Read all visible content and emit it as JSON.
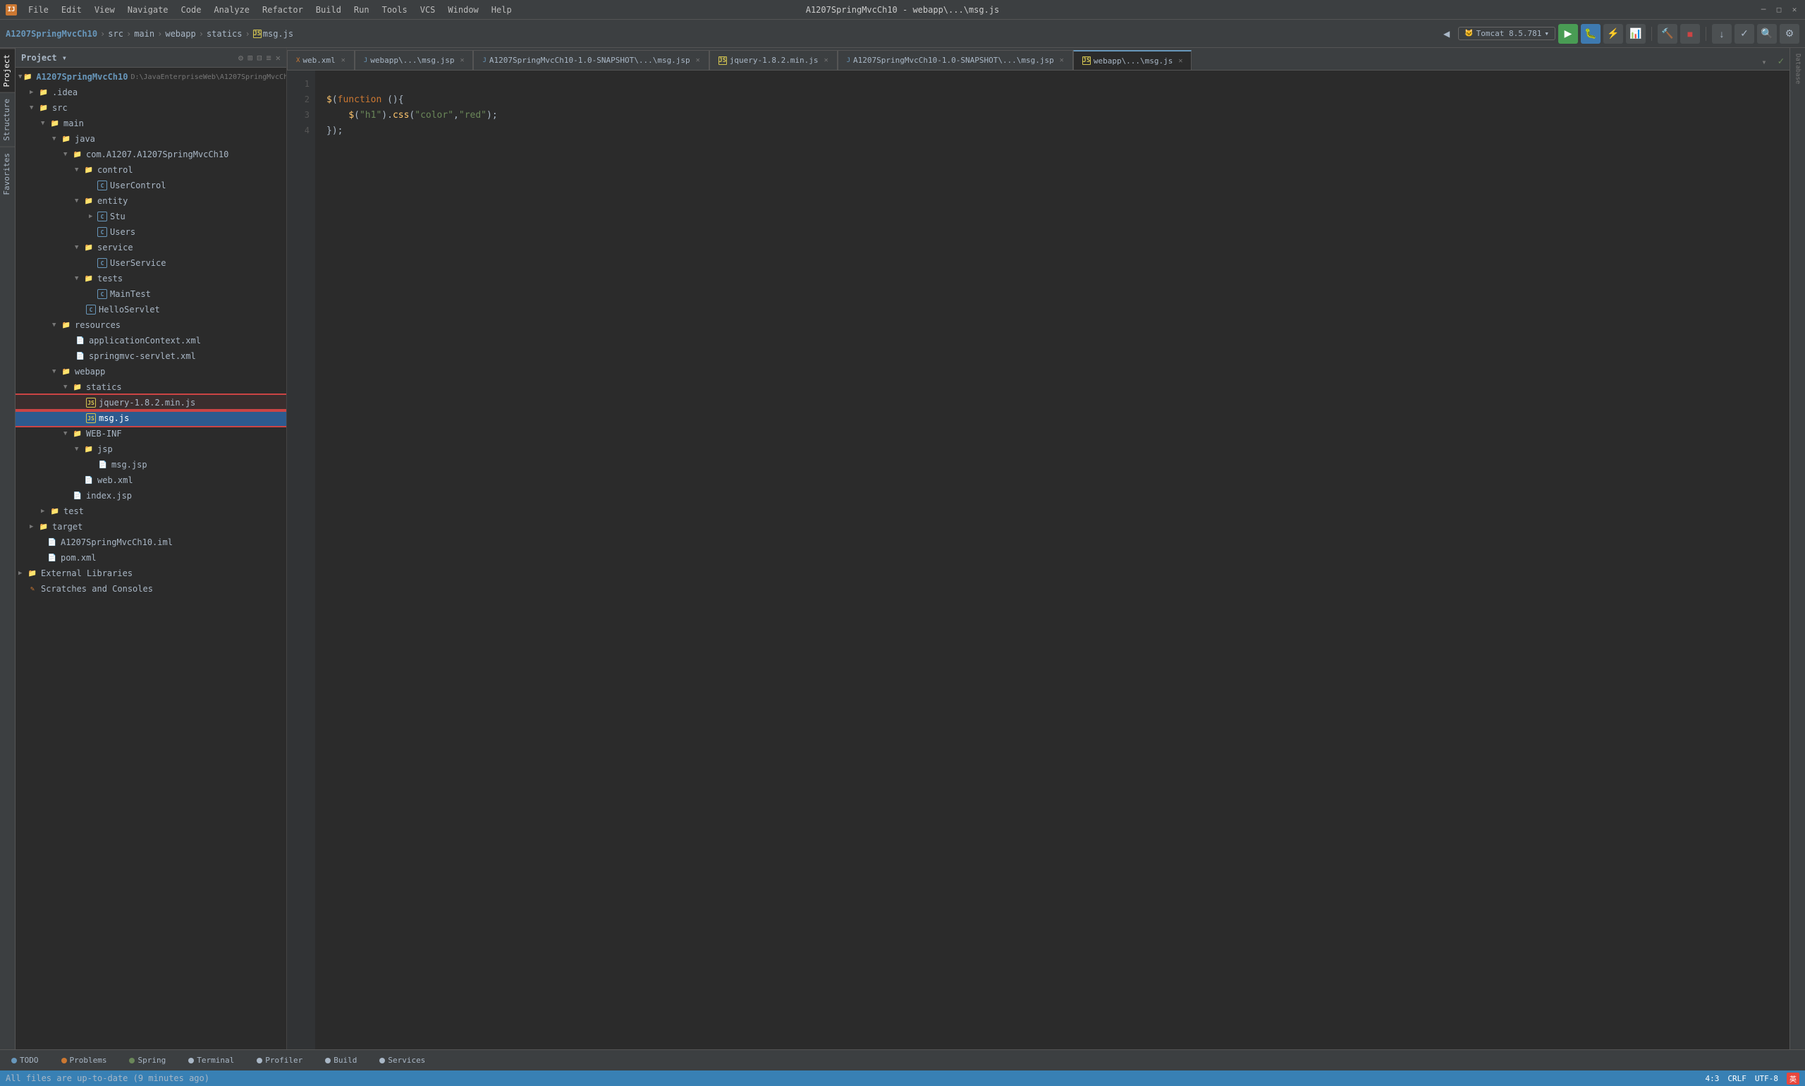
{
  "titlebar": {
    "app_name": "IntelliJ IDEA",
    "title": "A1207SpringMvcCh10 - webapp\\...\\msg.js",
    "menu": [
      "File",
      "Edit",
      "View",
      "Navigate",
      "Code",
      "Analyze",
      "Refactor",
      "Build",
      "Run",
      "Tools",
      "VCS",
      "Window",
      "Help"
    ]
  },
  "breadcrumb": {
    "project": "A1207SpringMvcCh10",
    "path": [
      "src",
      "main",
      "webapp",
      "statics",
      "msg.js"
    ]
  },
  "toolbar": {
    "tomcat": "Tomcat 8.5.781",
    "project_label": "Project ▾"
  },
  "tabs": [
    {
      "label": "web.xml",
      "type": "xml",
      "active": false
    },
    {
      "label": "webapp\\...\\msg.jsp",
      "type": "jsp",
      "active": false
    },
    {
      "label": "A1207SpringMvcCh10-1.0-SNAPSHOT\\...\\msg.jsp",
      "type": "jsp",
      "active": false
    },
    {
      "label": "jquery-1.8.2.min.js",
      "type": "js",
      "active": false
    },
    {
      "label": "A1207SpringMvcCh10-1.0-SNAPSHOT\\...\\msg.jsp",
      "type": "jsp",
      "active": false
    },
    {
      "label": "webapp\\...\\msg.js",
      "type": "js",
      "active": true
    }
  ],
  "code": {
    "lines": [
      {
        "num": 1,
        "content": ""
      },
      {
        "num": 2,
        "content": "$(function (){"
      },
      {
        "num": 3,
        "content": "    $(\"h1\").css(\"color\",\"red\");"
      },
      {
        "num": 4,
        "content": "});"
      }
    ]
  },
  "tree": {
    "project_name": "A1207SpringMvcCh10",
    "project_path": "D:\\JavaEnterpriseWeb\\A1207SpringMvcCh",
    "items": [
      {
        "label": ".idea",
        "type": "folder",
        "indent": 1,
        "expanded": false,
        "arrow": "▶"
      },
      {
        "label": "src",
        "type": "folder",
        "indent": 1,
        "expanded": true,
        "arrow": "▼"
      },
      {
        "label": "main",
        "type": "folder",
        "indent": 2,
        "expanded": true,
        "arrow": "▼"
      },
      {
        "label": "java",
        "type": "folder",
        "indent": 3,
        "expanded": true,
        "arrow": "▼"
      },
      {
        "label": "com.A1207.A1207SpringMvcCh10",
        "type": "folder",
        "indent": 4,
        "expanded": true,
        "arrow": "▼"
      },
      {
        "label": "control",
        "type": "folder",
        "indent": 5,
        "expanded": true,
        "arrow": "▼"
      },
      {
        "label": "UserControl",
        "type": "java",
        "indent": 6,
        "expanded": false,
        "arrow": ""
      },
      {
        "label": "entity",
        "type": "folder",
        "indent": 5,
        "expanded": true,
        "arrow": "▼"
      },
      {
        "label": "Stu",
        "type": "java",
        "indent": 6,
        "expanded": false,
        "arrow": "▶"
      },
      {
        "label": "Users",
        "type": "java",
        "indent": 6,
        "expanded": false,
        "arrow": ""
      },
      {
        "label": "service",
        "type": "folder",
        "indent": 5,
        "expanded": true,
        "arrow": "▼"
      },
      {
        "label": "UserService",
        "type": "java",
        "indent": 6,
        "expanded": false,
        "arrow": ""
      },
      {
        "label": "tests",
        "type": "folder",
        "indent": 5,
        "expanded": true,
        "arrow": "▼"
      },
      {
        "label": "MainTest",
        "type": "java",
        "indent": 6,
        "expanded": false,
        "arrow": ""
      },
      {
        "label": "HelloServlet",
        "type": "java",
        "indent": 5,
        "expanded": false,
        "arrow": ""
      },
      {
        "label": "resources",
        "type": "folder",
        "indent": 3,
        "expanded": true,
        "arrow": "▼"
      },
      {
        "label": "applicationContext.xml",
        "type": "xml",
        "indent": 4,
        "expanded": false,
        "arrow": ""
      },
      {
        "label": "springmvc-servlet.xml",
        "type": "xml",
        "indent": 4,
        "expanded": false,
        "arrow": ""
      },
      {
        "label": "webapp",
        "type": "folder",
        "indent": 3,
        "expanded": true,
        "arrow": "▼"
      },
      {
        "label": "statics",
        "type": "folder",
        "indent": 4,
        "expanded": true,
        "arrow": "▼"
      },
      {
        "label": "jquery-1.8.2.min.js",
        "type": "js",
        "indent": 5,
        "expanded": false,
        "arrow": "",
        "highlight": true
      },
      {
        "label": "msg.js",
        "type": "js",
        "indent": 5,
        "expanded": false,
        "arrow": "",
        "selected": true
      },
      {
        "label": "WEB-INF",
        "type": "folder",
        "indent": 4,
        "expanded": true,
        "arrow": "▼"
      },
      {
        "label": "jsp",
        "type": "folder",
        "indent": 5,
        "expanded": true,
        "arrow": "▼"
      },
      {
        "label": "msg.jsp",
        "type": "jsp",
        "indent": 6,
        "expanded": false,
        "arrow": ""
      },
      {
        "label": "web.xml",
        "type": "xml",
        "indent": 5,
        "expanded": false,
        "arrow": ""
      },
      {
        "label": "index.jsp",
        "type": "jsp",
        "indent": 4,
        "expanded": false,
        "arrow": ""
      },
      {
        "label": "test",
        "type": "folder",
        "indent": 2,
        "expanded": false,
        "arrow": "▶"
      },
      {
        "label": "target",
        "type": "folder",
        "indent": 1,
        "expanded": false,
        "arrow": "▶"
      },
      {
        "label": "A1207SpringMvcCh10.iml",
        "type": "iml",
        "indent": 1,
        "expanded": false,
        "arrow": ""
      },
      {
        "label": "pom.xml",
        "type": "xml",
        "indent": 1,
        "expanded": false,
        "arrow": ""
      },
      {
        "label": "External Libraries",
        "type": "folder",
        "indent": 0,
        "expanded": false,
        "arrow": "▶"
      },
      {
        "label": "Scratches and Consoles",
        "type": "scratch",
        "indent": 0,
        "expanded": false,
        "arrow": ""
      }
    ]
  },
  "bottom_tabs": [
    {
      "label": "TODO",
      "dot_class": "dot-todo"
    },
    {
      "label": "Problems",
      "dot_class": "dot-problems"
    },
    {
      "label": "Spring",
      "dot_class": "dot-spring"
    },
    {
      "label": "Terminal",
      "dot_class": "dot-terminal"
    },
    {
      "label": "Profiler",
      "dot_class": "dot-profiler"
    },
    {
      "label": "Build",
      "dot_class": "dot-build"
    },
    {
      "label": "Services",
      "dot_class": "dot-services"
    }
  ],
  "status": {
    "message": "All files are up-to-date (9 minutes ago)",
    "position": "4:3",
    "encoding": "CRLF",
    "charset": "UTF-8"
  },
  "right_tabs": [
    "Database"
  ],
  "left_tabs": [
    "Project",
    "Structure",
    "Favorites"
  ]
}
